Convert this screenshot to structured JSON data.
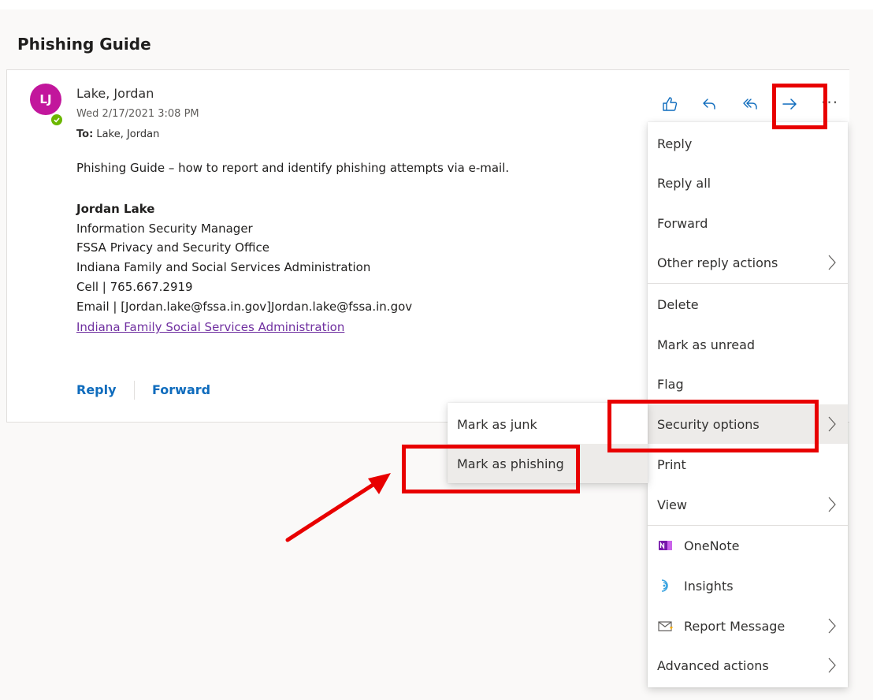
{
  "message": {
    "subject": "Phishing Guide",
    "avatar_initials": "LJ",
    "sender": "Lake, Jordan",
    "date": "Wed 2/17/2021 3:08 PM",
    "to_label": "To:",
    "to_value": "Lake, Jordan",
    "intro": "Phishing Guide – how to report and identify phishing attempts via e-mail.",
    "signature": {
      "name": "Jordan Lake",
      "title": "Information Security Manager",
      "office": "FSSA Privacy and Security Office",
      "agency": "Indiana Family and Social Services Administration",
      "cell": "Cell | 765.667.2919",
      "email": "Email | [Jordan.lake@fssa.in.gov]Jordan.lake@fssa.in.gov",
      "link": "Indiana Family Social Services Administration"
    }
  },
  "footer": {
    "reply": "Reply",
    "forward": "Forward"
  },
  "toolbar": {
    "like_icon": "thumbs-up-icon",
    "reply_icon": "reply-icon",
    "reply_all_icon": "reply-all-icon",
    "forward_icon": "forward-arrow-icon",
    "more": "···"
  },
  "menu": {
    "items": [
      {
        "label": "Reply"
      },
      {
        "label": "Reply all"
      },
      {
        "label": "Forward"
      },
      {
        "label": "Other reply actions"
      },
      {
        "label": "Delete"
      },
      {
        "label": "Mark as unread"
      },
      {
        "label": "Flag"
      },
      {
        "label": "Security options"
      },
      {
        "label": "Print"
      },
      {
        "label": "View"
      },
      {
        "label": "OneNote"
      },
      {
        "label": "Insights"
      },
      {
        "label": "Report Message"
      },
      {
        "label": "Advanced actions"
      }
    ]
  },
  "submenu": {
    "items": [
      {
        "label": "Mark as junk"
      },
      {
        "label": "Mark as phishing"
      }
    ]
  },
  "colors": {
    "accent": "#0f6cbd",
    "avatar": "#c2169c",
    "presence": "#6bb700",
    "highlight": "#e80000",
    "onenote": "#7719aa"
  }
}
